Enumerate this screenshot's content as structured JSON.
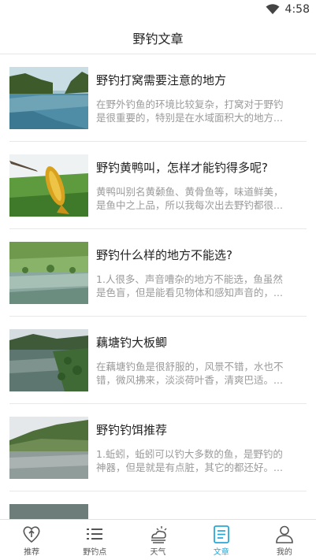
{
  "status_bar": {
    "time": "4:58"
  },
  "header": {
    "title": "野钓文章"
  },
  "articles": [
    {
      "title": "野钓打窝需要注意的地方",
      "desc_line1": "在野外钓鱼的环境比较复杂，打窝对于野钓",
      "desc_line2": "是很重要的，特别是在水域面积大的地方..."
    },
    {
      "title": "野钓黄鸭叫，怎样才能钓得多呢?",
      "desc_line1": "黄鸭叫别名黄颡鱼、黄骨鱼等，味道鲜美，",
      "desc_line2": "是鱼中之上品，所以我每次出去野钓都很..."
    },
    {
      "title": "野钓什么样的地方不能选?",
      "desc_line1": "1.人很多、声音嘈杂的地方不能选，鱼虽然",
      "desc_line2": "是色盲，但是能看见物体和感知声音的，..."
    },
    {
      "title": "藕塘钓大板鲫",
      "desc_line1": "在藕塘钓鱼是很舒服的，风景不错，水也不",
      "desc_line2": "错，微风拂来，淡淡荷叶香，清爽巴适。..."
    },
    {
      "title": "野钓钓饵推荐",
      "desc_line1": "1.蚯蚓，蚯蚓可以钓大多数的鱼，是野钓的",
      "desc_line2": "神器，但是就是有点脏，其它的都还好。..."
    }
  ],
  "tabs": [
    {
      "label": "推荐",
      "icon": "heart-arrow-icon"
    },
    {
      "label": "野钓点",
      "icon": "list-icon"
    },
    {
      "label": "天气",
      "icon": "weather-icon"
    },
    {
      "label": "文章",
      "icon": "article-icon"
    },
    {
      "label": "我的",
      "icon": "user-icon"
    }
  ],
  "colors": {
    "accent": "#2aa7d6",
    "inactive": "#555555"
  }
}
